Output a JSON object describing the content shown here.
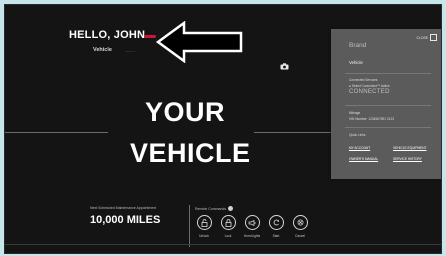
{
  "header": {
    "greeting": "HELLO, JOHN",
    "vehicle_label": "Vehicle",
    "vehicle_sub": "..........."
  },
  "hero": {
    "line1": "YOUR",
    "line2": "VEHICLE"
  },
  "maintenance": {
    "label": "Next Scheduled Maintenance Appointment",
    "miles": "10,000 MILES"
  },
  "remote": {
    "label": "Remote Commands",
    "commands": [
      {
        "label": "Unlock",
        "icon": "unlock-icon"
      },
      {
        "label": "Lock",
        "icon": "lock-icon"
      },
      {
        "label": "Horn/Lights",
        "icon": "horn-icon"
      },
      {
        "label": "Start",
        "icon": "start-icon"
      },
      {
        "label": "Cancel",
        "icon": "cancel-icon"
      }
    ]
  },
  "panel": {
    "close": "CLOSE",
    "brand": "Brand",
    "vehicle": "Vehicle",
    "services_label": "Connected Services",
    "services_status": "● Select Connected™ Active",
    "logo_text": "CONNECTED",
    "mileage_label": "Mileage",
    "mileage_value": "VIN Number: 1234567891 0123",
    "quick_links_label": "Quick Links",
    "links": [
      "MY ACCOUNT",
      "VEHICLE EQUIPMENT",
      "OWNER'S MANUAL",
      "SERVICE HISTORY"
    ]
  },
  "colors": {
    "background": "#141414",
    "accent": "#c7163a",
    "panel": "#5b5b5b"
  }
}
